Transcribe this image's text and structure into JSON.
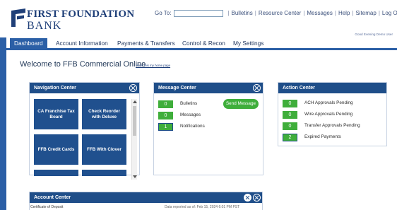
{
  "brand": {
    "name_line1": "FIRST FOUNDATION",
    "name_line2": "BANK"
  },
  "topnav": {
    "goto_label": "Go To:",
    "goto_value": "",
    "links": [
      "Bulletins",
      "Resource Center",
      "Messages",
      "Help",
      "Sitemap",
      "Log Off"
    ]
  },
  "greeting": "Good Evening Demo User",
  "tabs": [
    "Dashboard",
    "Account Information",
    "Payments & Transfers",
    "Control & Recon",
    "My Settings"
  ],
  "active_tab": "Dashboard",
  "welcome": {
    "title": "Welcome to FFB Commercial Online",
    "home_link": "Make this my home page"
  },
  "navigation_center": {
    "title": "Navigation Center",
    "tiles": [
      "CA Franchise Tax Board",
      "Check Reorder with Deluxe",
      "FFB Credit Cards",
      "FFB With Clover",
      "",
      ""
    ]
  },
  "message_center": {
    "title": "Message Center",
    "send_button": "Send Message",
    "rows": [
      {
        "count": "0",
        "label": "Bulletins"
      },
      {
        "count": "0",
        "label": "Messages"
      },
      {
        "count": "1",
        "label": "Notifications"
      }
    ]
  },
  "action_center": {
    "title": "Action Center",
    "rows": [
      {
        "count": "0",
        "label": "ACH Approvals Pending"
      },
      {
        "count": "0",
        "label": "Wire Approvals Pending"
      },
      {
        "count": "0",
        "label": "Transfer Approvals Pending"
      },
      {
        "count": "2",
        "label": "Expired Payments"
      }
    ]
  },
  "account_center": {
    "title": "Account Center",
    "first_row": "Certificate of Deposit",
    "date_text": "Data reported as of: Feb 15, 2024 6:01 PM PST"
  },
  "colors": {
    "header_blue": "#1f4e89",
    "tab_blue": "#2b5fa6",
    "count_green": "#3fae3b",
    "brand_navy": "#1f3f78"
  }
}
